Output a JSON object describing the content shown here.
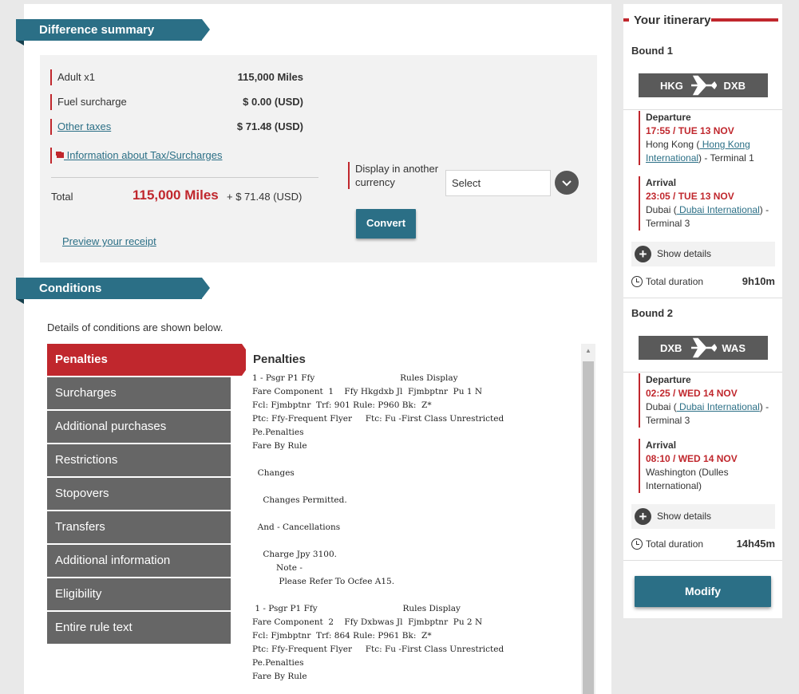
{
  "summary": {
    "title": "Difference summary",
    "rows": [
      {
        "label": "Adult x1",
        "value": "115,000 Miles"
      },
      {
        "label": "Fuel surcharge",
        "value": "$ 0.00 (USD)"
      },
      {
        "label": "Other taxes",
        "value": "$ 71.48 (USD)"
      }
    ],
    "tax_info_link": " Information about Tax/Surcharges",
    "total_label": "Total",
    "total_miles": "115,000 Miles",
    "total_usd": "+ $ 71.48 (USD)",
    "preview_link": "Preview your receipt",
    "currency_label": "Display in another currency",
    "currency_select": "Select",
    "convert_button": "Convert"
  },
  "conditions": {
    "title": "Conditions",
    "intro": "Details of conditions are shown below.",
    "tabs": [
      "Penalties",
      "Surcharges",
      "Additional purchases",
      "Restrictions",
      "Stopovers",
      "Transfers",
      "Additional information",
      "Eligibility",
      "Entire rule text"
    ],
    "active_tab": "Penalties",
    "rule_title": "Penalties",
    "rule_text": "1 - Psgr P1 Ffy                                Rules Display\nFare Component  1    Ffy Hkgdxb Jl  Fjmbptnr  Pu 1 N\nFcl: Fjmbptnr  Trf: 901 Rule: P960 Bk:  Z*\nPtc: Ffy-Frequent Flyer     Ftc: Fu -First Class Unrestricted\nPe.Penalties\nFare By Rule\n\n  Changes\n\n    Changes Permitted.\n\n  And - Cancellations\n\n    Charge Jpy 3100.\n         Note -\n          Please Refer To Ocfee A15.\n\n 1 - Psgr P1 Ffy                                Rules Display\nFare Component  2    Ffy Dxbwas Jl  Fjmbptnr  Pu 2 N\nFcl: Fjmbptnr  Trf: 864 Rule: P961 Bk:  Z*\nPtc: Ffy-Frequent Flyer     Ftc: Fu -First Class Unrestricted\nPe.Penalties\nFare By Rule"
  },
  "itinerary": {
    "title": "Your itinerary",
    "bounds": [
      {
        "title": "Bound 1",
        "from": "HKG",
        "to": "DXB",
        "departure": {
          "label": "Departure",
          "time": "17:55 / TUE 13 NOV",
          "city": "Hong Kong (",
          "airport": " Hong Kong International",
          "rest": ") - Terminal  1"
        },
        "arrival": {
          "label": "Arrival",
          "time": "23:05 / TUE 13 NOV",
          "city": "Dubai (",
          "airport": " Dubai International",
          "rest": ") - Terminal  3"
        },
        "show_details": "Show details",
        "duration_label": "Total duration",
        "duration": "9h10m"
      },
      {
        "title": "Bound 2",
        "from": "DXB",
        "to": "WAS",
        "departure": {
          "label": "Departure",
          "time": "02:25 / WED 14 NOV",
          "city": "Dubai (",
          "airport": " Dubai International",
          "rest": ") - Terminal  3"
        },
        "arrival": {
          "label": "Arrival",
          "time": "08:10 / WED 14 NOV",
          "city": "Washington (Dulles International)",
          "airport": "",
          "rest": ""
        },
        "show_details": "Show details",
        "duration_label": "Total duration",
        "duration": "14h45m"
      }
    ],
    "modify_button": "Modify"
  },
  "colors": {
    "accent_teal": "#2b6f86",
    "accent_red": "#c0272d",
    "tab_gray": "#666666"
  }
}
